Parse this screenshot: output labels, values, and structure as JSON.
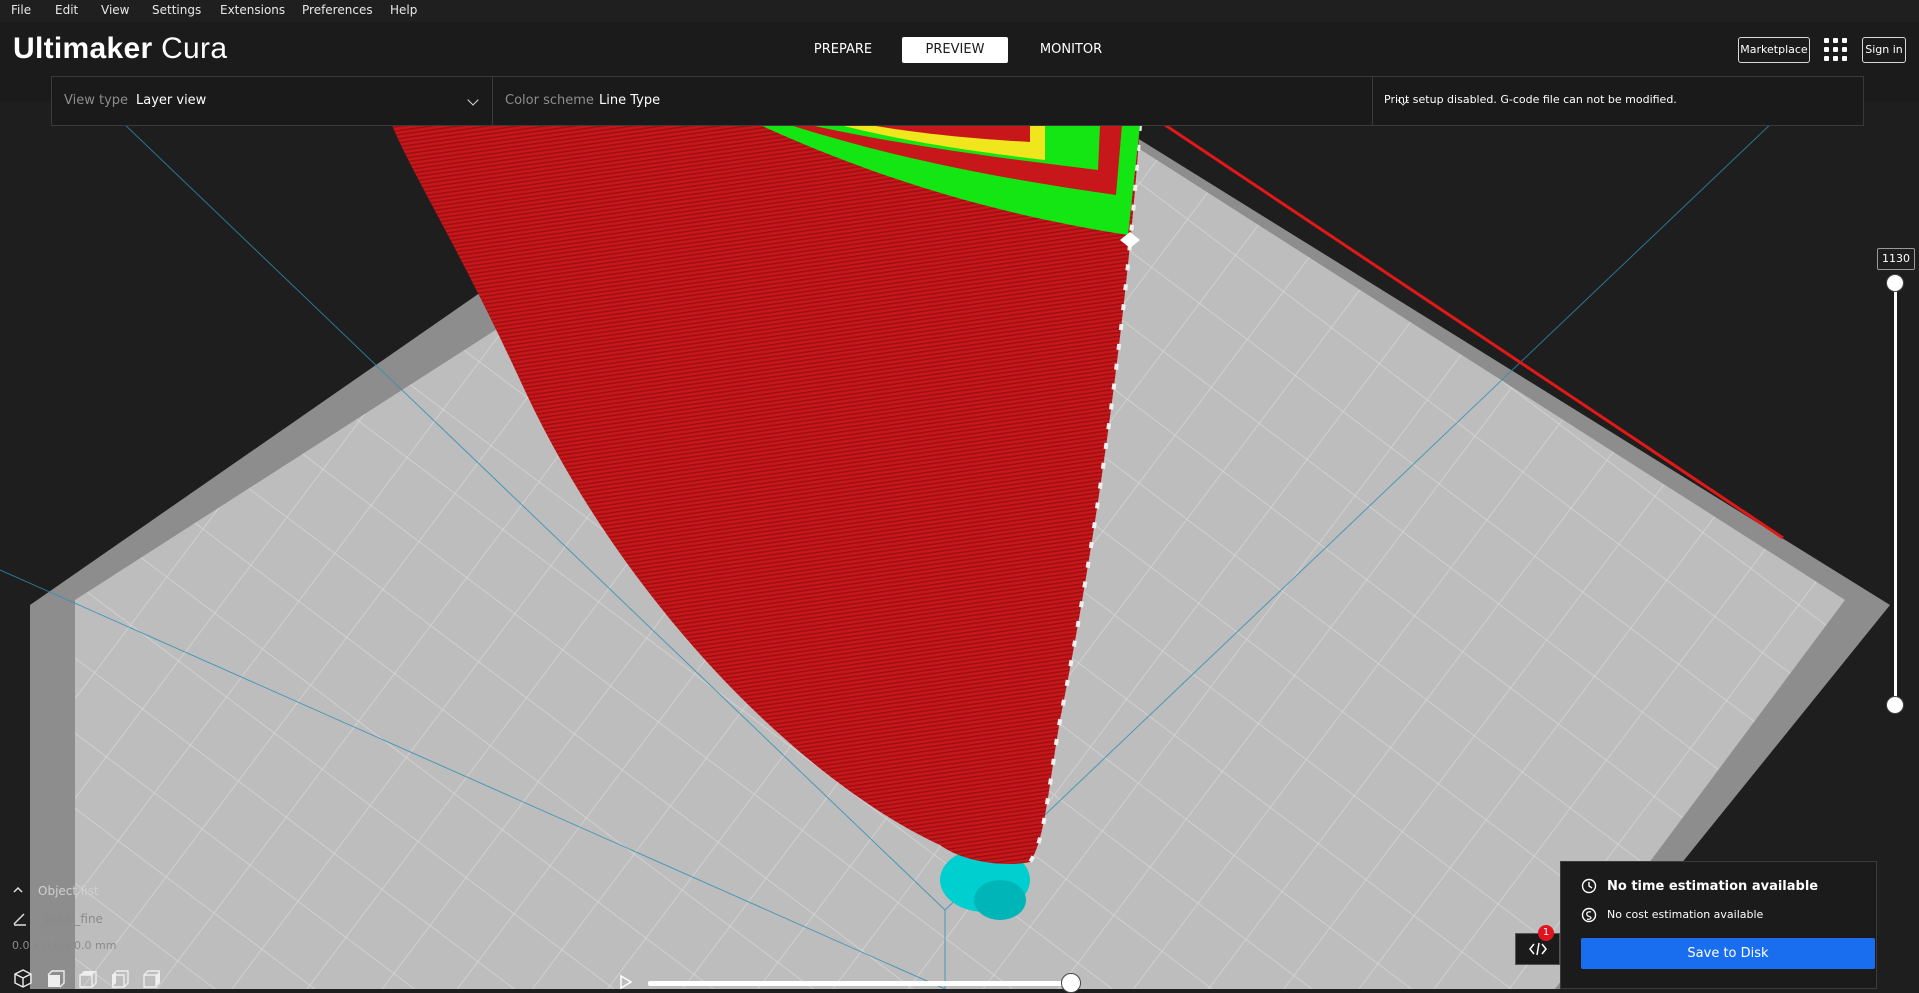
{
  "menu": [
    "File",
    "Edit",
    "View",
    "Settings",
    "Extensions",
    "Preferences",
    "Help"
  ],
  "app": {
    "brand_bold": "Ultimaker",
    "brand_light": "Cura"
  },
  "stages": [
    {
      "label": "PREPARE",
      "active": false
    },
    {
      "label": "PREVIEW",
      "active": true
    },
    {
      "label": "MONITOR",
      "active": false
    }
  ],
  "header": {
    "marketplace": "Marketplace",
    "sign_in": "Sign in"
  },
  "settings_bar": {
    "view_type_label": "View type",
    "view_type_value": "Layer view",
    "color_scheme_label": "Color scheme",
    "color_scheme_value": "Line Type",
    "print_setup_message": "Print setup disabled. G-code file can not be modified."
  },
  "layer_slider": {
    "current_layer": "1130"
  },
  "object_list": {
    "title": "Object list",
    "object_name": "petal_fine",
    "dimensions": "0.0 x 0.0 x 0.0 mm"
  },
  "action_panel": {
    "time_estimation": "No time estimation available",
    "cost_estimation": "No cost estimation available",
    "save_button": "Save to Disk",
    "notification_count": "1"
  },
  "colors": {
    "accent_blue": "#196ef0",
    "wall_red": "#d91414",
    "infill_yellow": "#f0e61e",
    "inner_wall_green": "#14e614",
    "support_cyan": "#00d2d2",
    "build_plate": "#bdbdbd"
  }
}
